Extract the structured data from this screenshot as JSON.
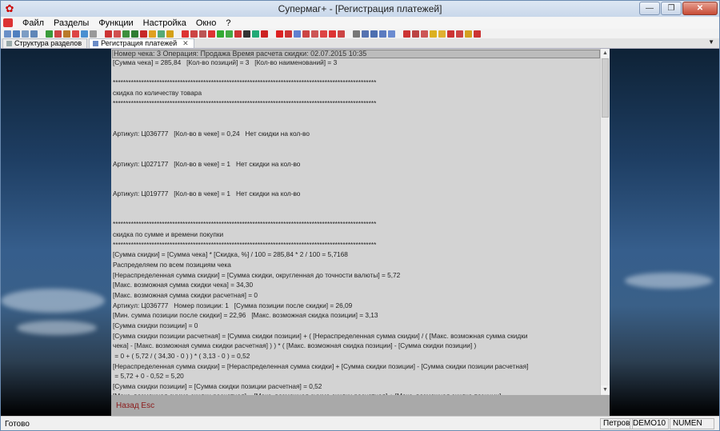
{
  "window": {
    "title": "Супермаг+  - [Регистрация платежей]",
    "min_glyph": "—",
    "restore_glyph": "❐",
    "close_glyph": "✕"
  },
  "menu": [
    "Файл",
    "Разделы",
    "Функции",
    "Настройка",
    "Окно",
    "?"
  ],
  "tabs": [
    {
      "label": "Структура разделов"
    },
    {
      "label": "Регистрация платежей",
      "close": "✕"
    }
  ],
  "tabs_dropdown": "▼",
  "panel": {
    "header": "Номер чека: 3   Операция: Продажа   Время расчета скидки: 02.07.2015 10:35",
    "lines": [
      "[Сумма чека] = 285,84   [Кол-во позиций] = 3   [Кол-во наименований] = 3",
      "",
      "******************************************************************************************************",
      "скидка по количеству товара",
      "******************************************************************************************************",
      "",
      "",
      "Артикул: Ц036777   [Кол-во в чеке] = 0,24   Нет скидки на кол-во",
      "",
      "",
      "Артикул: Ц027177   [Кол-во в чеке] = 1   Нет скидки на кол-во",
      "",
      "",
      "Артикул: Ц019777   [Кол-во в чеке] = 1   Нет скидки на кол-во",
      "",
      "",
      "******************************************************************************************************",
      "скидка по сумме и времени покупки",
      "******************************************************************************************************",
      "[Сумма скидки] = [Сумма чека] * [Скидка, %] / 100 = 285,84 * 2 / 100 = 5,7168",
      "Распределяем по всем позициям чека",
      "[Нераспределенная сумма скидки] = [Сумма скидки, округленная до точности валюты] = 5,72",
      "[Макс. возможная сумма скидки чека] = 34,30",
      "[Макс. возможная сумма скидки расчетная] = 0",
      "Артикул: Ц036777   Номер позиции: 1   [Сумма позиции после скидки] = 26,09",
      "[Мин. сумма позиции после скидки] = 22,96   [Макс. возможная скидка позиции] = 3,13",
      "[Сумма скидки позиции] = 0",
      "[Сумма скидки позиции расчетная] = [Сумма скидки позиции] + ( [Нераспределенная сумма скидки] / ( [Макс. возможная сумма скидки",
      "чека] - [Макс. возможная сумма скидки расчетная] ) ) * ( [Макс. возможная скидка позиции] - [Сумма скидки позиции] )",
      " = 0 + ( 5,72 / ( 34,30 - 0 ) ) * ( 3,13 - 0 ) = 0,52",
      "[Нераспределенная сумма скидки] = [Нераспределенная сумма скидки] + [Сумма скидки позиции] - [Сумма скидки позиции расчетная]",
      " = 5,72 + 0 - 0,52 = 5,20",
      "[Сумма скидки позиции] = [Сумма скидки позиции расчетная] = 0,52",
      "[Макс. возможная сумма скидки расчетная] = [Макс. возможная сумма скидки расчетная] + [Макс. возможная скидка позиции]"
    ],
    "back_button": "Назад Esc",
    "scroll_up": "▲",
    "scroll_down": "▼"
  },
  "status": {
    "left": "Готово",
    "user": "Петров",
    "db": "DEMO10",
    "numlock": "NUMEN"
  },
  "colors": {
    "back_button": "#8b1a1a",
    "panel_bg": "#d3d3d3",
    "footer_bg": "#a9a9a9"
  }
}
